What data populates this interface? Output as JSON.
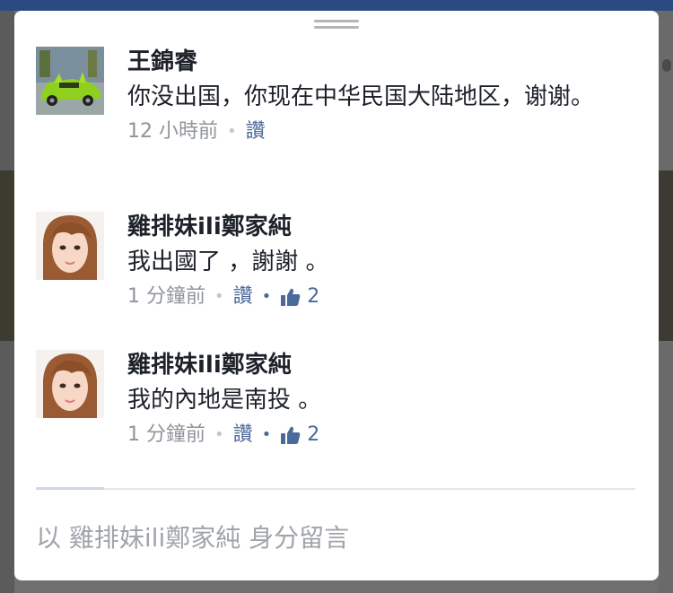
{
  "comments": [
    {
      "name": "王錦睿",
      "text": "你没出国，你现在中华民国大陆地区，谢谢。",
      "time": "12 小時前",
      "like_label": "讚",
      "like_count": ""
    },
    {
      "name": "雞排妹ili鄭家純",
      "text": "我出國了 ，謝謝 。",
      "time": "1 分鐘前",
      "like_label": "讚",
      "like_count": "2"
    },
    {
      "name": "雞排妹ili鄭家純",
      "text": "我的內地是南投 。",
      "time": "1 分鐘前",
      "like_label": "讚",
      "like_count": "2"
    }
  ],
  "composer": {
    "placeholder": "以 雞排妹ili鄭家純 身分留言"
  },
  "icons": {
    "like": "thumbs-up-icon",
    "handle": "drag-handle-icon"
  },
  "colors": {
    "link": "#4b6a9b",
    "meta": "#90949c",
    "text": "#1d2129"
  }
}
